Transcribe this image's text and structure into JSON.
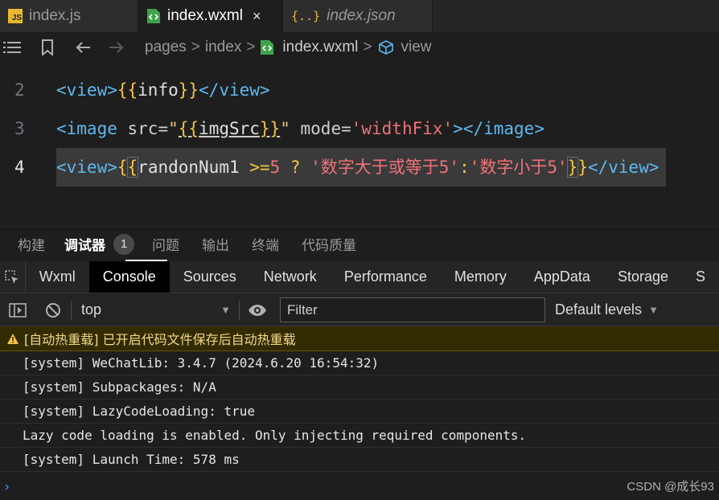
{
  "tabs": [
    {
      "label": "index.js",
      "icon": "js-file-icon"
    },
    {
      "label": "index.wxml",
      "icon": "wxml-file-icon",
      "close": "×"
    },
    {
      "label": "index.json",
      "icon": "json-file-icon"
    }
  ],
  "breadcrumb": {
    "items": [
      "pages",
      "index",
      "index.wxml",
      "view"
    ],
    "separator": ">"
  },
  "code": {
    "line_numbers": [
      "2",
      "3",
      "4"
    ],
    "line2": {
      "open": "<view>",
      "braces_open": "{{",
      "var": "info",
      "braces_close": "}}",
      "close": "</view>"
    },
    "line3": {
      "open": "<image",
      "attr_src": "src=",
      "q": "\"",
      "braces_open": "{{",
      "var": "imgSrc",
      "braces_close": "}}",
      "attr_mode": "mode=",
      "mode_value": "'widthFix'",
      "close": "></image>"
    },
    "line4": {
      "open": "<view>",
      "brace1": "{",
      "brace2": "{",
      "var": "randonNum1 ",
      "op": ">=",
      "num": "5",
      "q": " ? ",
      "str1": "'数字大于或等于5'",
      "colon": ":",
      "str2": "'数字小于5'",
      "brace3": "}",
      "brace4": "}",
      "close": "</view>"
    }
  },
  "panel_tabs": [
    "构建",
    "调试器",
    "问题",
    "输出",
    "终端",
    "代码质量"
  ],
  "debugger_badge": "1",
  "devtools_tabs": [
    "Wxml",
    "Console",
    "Sources",
    "Network",
    "Performance",
    "Memory",
    "AppData",
    "Storage",
    "S"
  ],
  "console_toolbar": {
    "context": "top",
    "filter_placeholder": "Filter",
    "levels": "Default levels"
  },
  "messages": {
    "warning": "[自动热重载] 已开启代码文件保存后自动热重载",
    "lines": [
      "[system] WeChatLib: 3.4.7 (2024.6.20 16:54:32)",
      "[system] Subpackages: N/A",
      "[system] LazyCodeLoading: true",
      "Lazy code loading is enabled. Only injecting required components.",
      "[system] Launch Time: 578 ms"
    ]
  },
  "prompt": "›",
  "watermark": "CSDN @成长93",
  "colors": {
    "accent_blue": "#5cb8f0",
    "string_red": "#f07178",
    "brace_yellow": "#f5c542",
    "warning_bg": "#332b00"
  }
}
